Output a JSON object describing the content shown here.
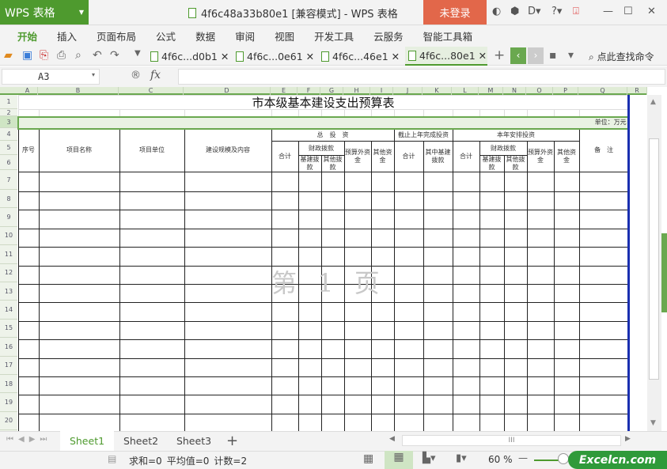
{
  "app": {
    "logo_label": "WPS 表格",
    "window_title": "4f6c48a33b80e1 [兼容模式] - WPS 表格",
    "login_label": "未登录"
  },
  "menu": [
    "开始",
    "插入",
    "页面布局",
    "公式",
    "数据",
    "审阅",
    "视图",
    "开发工具",
    "云服务",
    "智能工具箱"
  ],
  "doc_tabs": [
    "4f6c...d0b1",
    "4f6c...0e61",
    "4f6c...46e1",
    "4f6c...80e1"
  ],
  "search_command": "点此查找命令",
  "formula": {
    "cell_ref": "A3",
    "fx": "fx",
    "value": ""
  },
  "columns": [
    "A",
    "B",
    "C",
    "D",
    "E",
    "F",
    "G",
    "H",
    "I",
    "J",
    "K",
    "L",
    "M",
    "N",
    "O",
    "P",
    "Q",
    "R"
  ],
  "rows": [
    "1",
    "2",
    "3",
    "4",
    "5",
    "6",
    "7",
    "8",
    "9",
    "10",
    "11",
    "12",
    "13",
    "14",
    "15",
    "16",
    "17",
    "18",
    "19",
    "20"
  ],
  "sheet": {
    "title": "市本级基本建设支出预算表",
    "unit": "单位：万元",
    "headers": {
      "seq": "序号",
      "name": "项目名称",
      "unit": "项目单位",
      "scale": "建设规模及内容",
      "total_invest": "总　投　资",
      "prior_done": "截止上年完成投资",
      "this_year": "本年安排投资",
      "remarks": "备　注",
      "sum": "合计",
      "fiscal": "财政拨款",
      "extra_budget": "预算外资金",
      "other_funds": "其他资金",
      "of_which_infra": "其中基建拨款",
      "infra_grant": "基建拨款",
      "other_grant": "其他拨款"
    }
  },
  "watermark": "第 1 页",
  "sheet_tabs": [
    "Sheet1",
    "Sheet2",
    "Sheet3"
  ],
  "status": {
    "sum": "求和=0",
    "avg": "平均值=0",
    "count": "计数=2",
    "zoom": "60 %"
  },
  "brand": "Excelcn.com"
}
